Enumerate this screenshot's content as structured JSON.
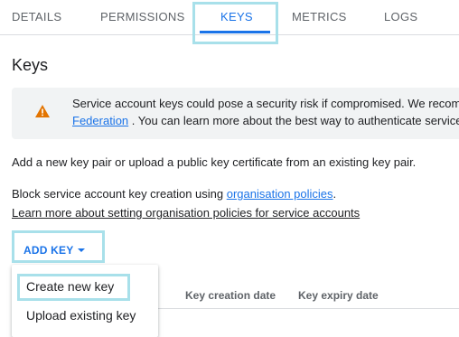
{
  "tabs": [
    {
      "label": "DETAILS"
    },
    {
      "label": "PERMISSIONS"
    },
    {
      "label": "KEYS"
    },
    {
      "label": "METRICS"
    },
    {
      "label": "LOGS"
    }
  ],
  "active_tab": "KEYS",
  "page_title": "Keys",
  "banner": {
    "line1": "Service account keys could pose a security risk if compromised. We recom",
    "line2_link": "Federation",
    "line2_text": " . You can learn more about the best way to authenticate service"
  },
  "body": {
    "add_text": "Add a new key pair or upload a public key certificate from an existing key pair.",
    "block_text": "Block service account key creation using ",
    "org_policies_link": "organisation policies",
    "block_text_end": ".",
    "learn_more_link": "Learn more about setting organisation policies for service accounts"
  },
  "add_key_button": {
    "label": "ADD KEY"
  },
  "table": {
    "columns": [
      "Key creation date",
      "Key expiry date"
    ]
  },
  "menu": {
    "items": [
      {
        "label": "Create new key"
      },
      {
        "label": "Upload existing key"
      }
    ]
  },
  "colors": {
    "accent": "#1a73e8",
    "warning": "#e37400",
    "highlight": "#a8e0ea"
  }
}
